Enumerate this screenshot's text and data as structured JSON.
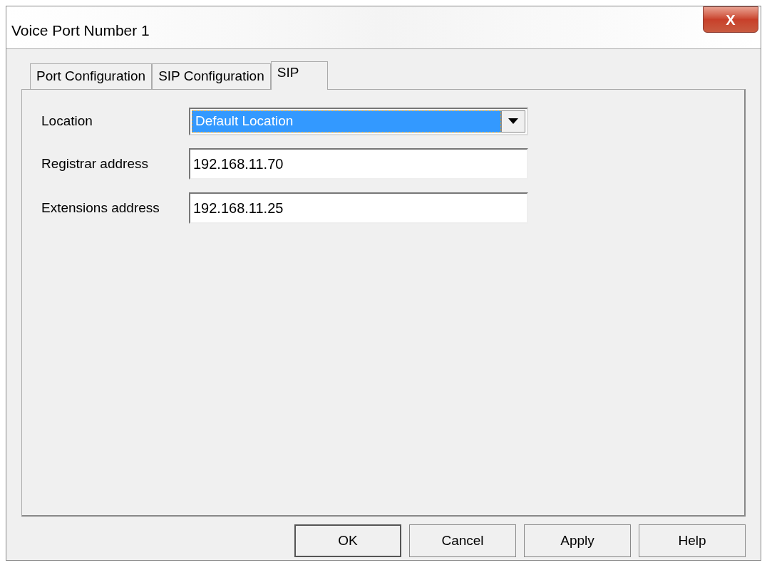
{
  "window": {
    "title": "Voice Port Number 1",
    "close_label": "X"
  },
  "tabs": [
    {
      "label": "Port Configuration",
      "selected": false
    },
    {
      "label": "SIP Configuration",
      "selected": false
    },
    {
      "label": "SIP",
      "selected": true
    }
  ],
  "fields": [
    {
      "kind": "dropdown",
      "label": "Location",
      "value": "Default Location",
      "focused": true
    },
    {
      "kind": "text",
      "label": "Registrar address",
      "value": "192.168.11.70",
      "focused": false
    },
    {
      "kind": "text",
      "label": "Extensions address",
      "value": "192.168.11.25",
      "focused": false
    }
  ],
  "buttons": [
    {
      "label": "OK",
      "default": true
    },
    {
      "label": "Cancel",
      "default": false
    },
    {
      "label": "Apply",
      "default": false
    },
    {
      "label": "Help",
      "default": false
    }
  ]
}
